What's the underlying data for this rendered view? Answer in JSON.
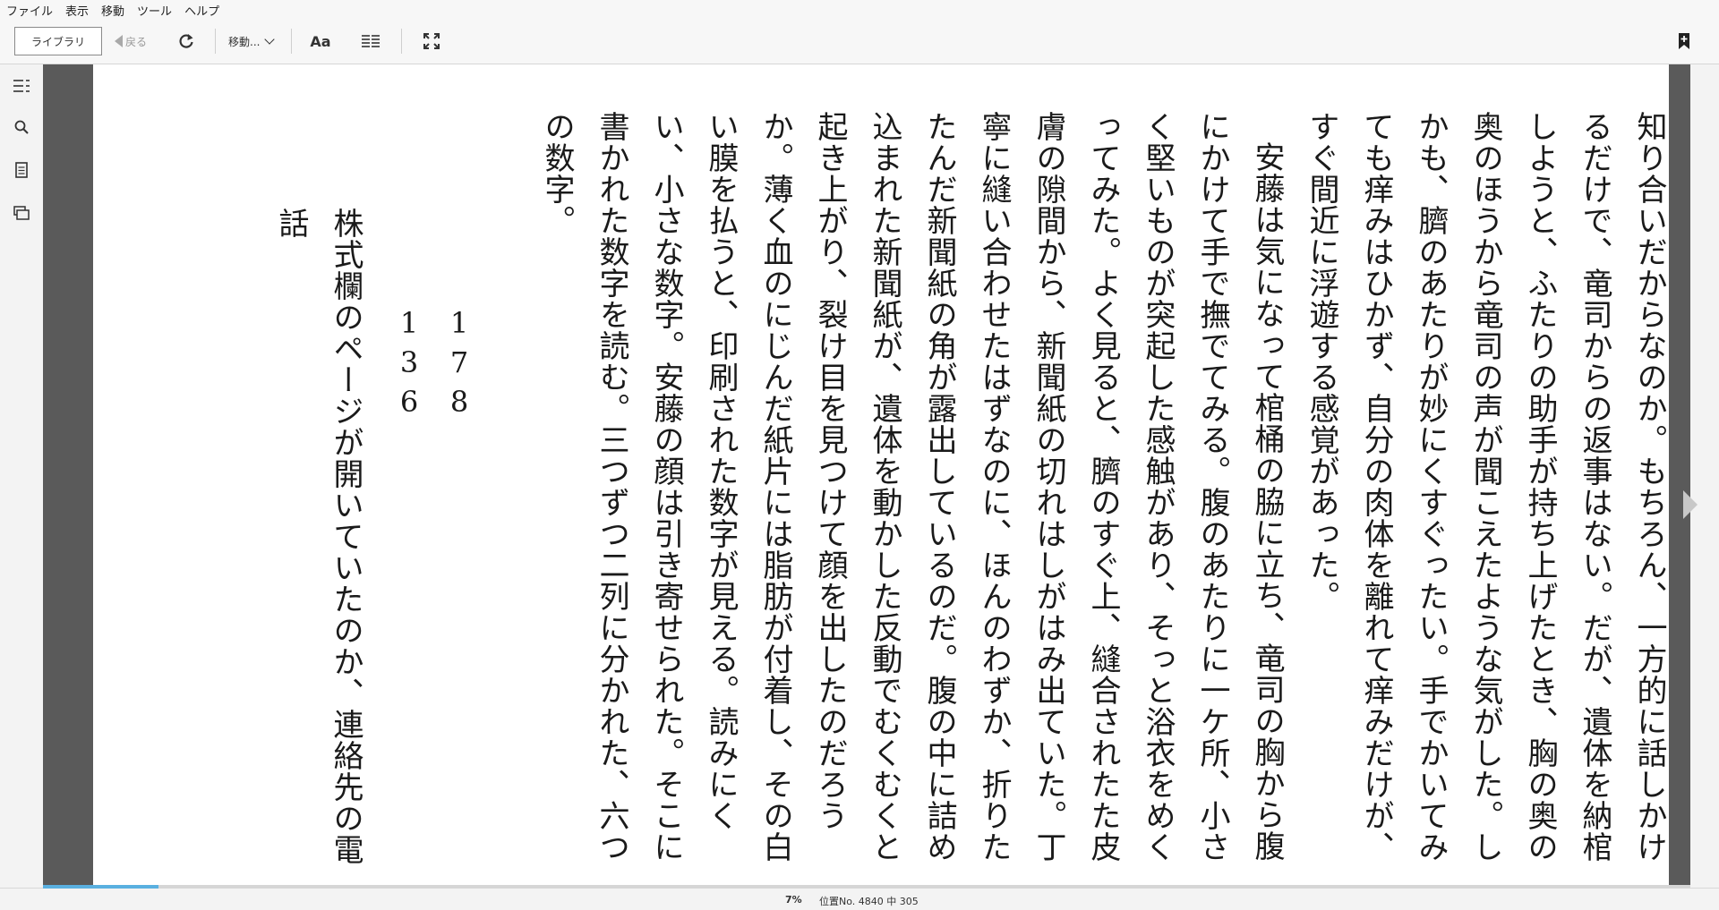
{
  "menu": [
    "ファイル",
    "表示",
    "移動",
    "ツール",
    "ヘルプ"
  ],
  "toolbar": {
    "library_label": "ライブラリ",
    "back_label": "戻る",
    "goto_label": "移動...",
    "font_label": "Aa"
  },
  "book": {
    "paragraphs": [
      "知り合いだからなのか。もちろん、一方的に話しかけるだけで、竜司からの返事はない。だが、遺体を納棺しようと、ふたりの助手が持ち上げたとき、胸の奥の奥のほうから竜司の声が聞こえたような気がした。しかも、臍のあたりが妙にくすぐったい。手でかいてみても痒みはひかず、自分の肉体を離れて痒みだけが、すぐ間近に浮遊する感覚があった。",
      "安藤は気になって棺桶の脇に立ち、竜司の胸から腹にかけて手で撫でてみる。腹のあたりに一ケ所、小さく堅いものが突起した感触があり、そっと浴衣をめくってみた。よく見ると、臍のすぐ上、縫合されたた皮膚の隙間から、新聞紙の切れはしがはみ出ていた。丁寧に縫い合わせたはずなのに、ほんのわずか、折りたたんだ新聞紙の角が露出しているのだ。腹の中に詰め込まれた新聞紙が、遺体を動かした反動でむくむくと起き上がり、裂け目を見つけて顔を出したのだろうか。薄く血のにじんだ紙片には脂肪が付着し、その白い膜を払うと、印刷された数字が見える。読みにくい、小さな数字。安藤の顔は引き寄せられた。そこに書かれた数字を読む。三つずつ二列に分かれた、六つの数字。"
    ],
    "numbers_col1": "178",
    "numbers_col2": "136",
    "caption": "株式欄のページが開いていたのか、連絡先の電話"
  },
  "status": {
    "percent_label": "7%",
    "location_label": "位置No. 4840 中 305",
    "progress": 0.07
  }
}
